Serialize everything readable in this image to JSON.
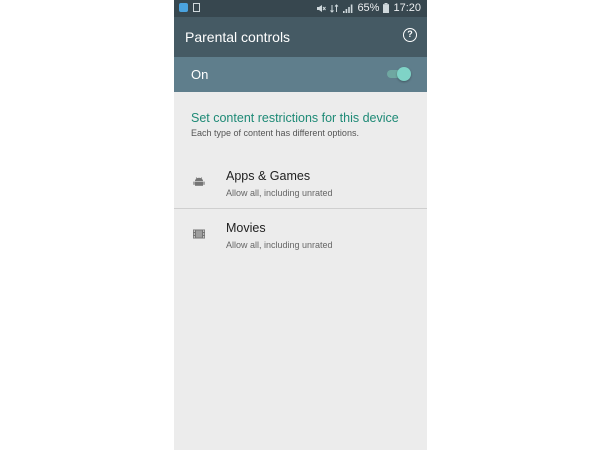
{
  "status_bar": {
    "battery_percent": "65%",
    "time": "17:20"
  },
  "toolbar": {
    "title": "Parental controls",
    "help_icon": "help-circle-icon"
  },
  "master_switch": {
    "label": "On",
    "state": "on",
    "accent_color": "#7fd3c7"
  },
  "section": {
    "title": "Set content restrictions for this device",
    "subtitle": "Each type of content has different options."
  },
  "items": [
    {
      "title": "Apps & Games",
      "subtitle": "Allow all, including unrated",
      "icon": "android-icon"
    },
    {
      "title": "Movies",
      "subtitle": "Allow all, including unrated",
      "icon": "film-icon"
    }
  ],
  "colors": {
    "toolbar": "#455a64",
    "switch_bar": "#5f7e8c",
    "accent_text": "#1e8a76",
    "background": "#ececec"
  }
}
